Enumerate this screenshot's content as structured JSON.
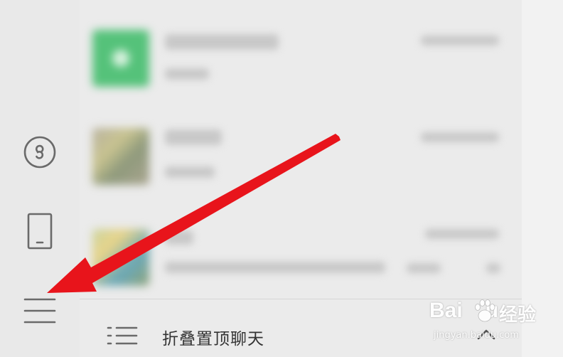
{
  "sidebar": {
    "items": [
      {
        "icon": "miniprogram-icon"
      },
      {
        "icon": "phone-icon"
      },
      {
        "icon": "menu-icon"
      }
    ]
  },
  "chat_list": {
    "items": [
      {
        "avatar": "green-miniprogram-avatar"
      },
      {
        "avatar": "photo-avatar"
      },
      {
        "avatar": "colorful-avatar"
      }
    ]
  },
  "fold_bar": {
    "label": "折叠置顶聊天",
    "icon": "list-icon",
    "chevron": "chevron-up-icon"
  },
  "annotation": {
    "arrow_color": "#e8141b",
    "points_to": "menu-icon"
  },
  "watermark": {
    "brand_latin": "Bai",
    "brand_latin_tail": "u",
    "brand_cn": "经验",
    "url": "jingyan.baidu.com"
  }
}
